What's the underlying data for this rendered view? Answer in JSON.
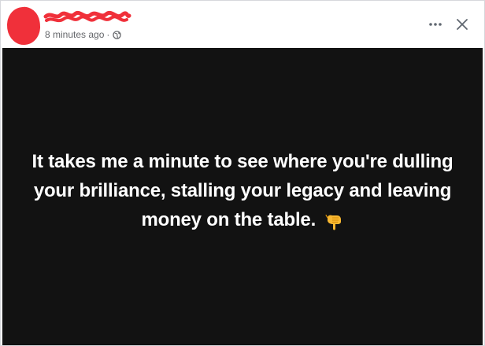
{
  "post": {
    "timestamp": "8 minutes ago",
    "separator": "·",
    "audience_icon": "globe-icon",
    "body_text": "It takes me a minute to see where you're dulling your brilliance, stalling your legacy and leaving money on the table.",
    "body_emoji_icon": "backhand-index-pointing-down-icon"
  },
  "header": {
    "more_icon": "more-options-icon",
    "close_icon": "close-icon"
  },
  "colors": {
    "redaction": "#f0303a",
    "content_background": "#121212",
    "text": "#ffffff",
    "meta_text": "#65676b"
  }
}
